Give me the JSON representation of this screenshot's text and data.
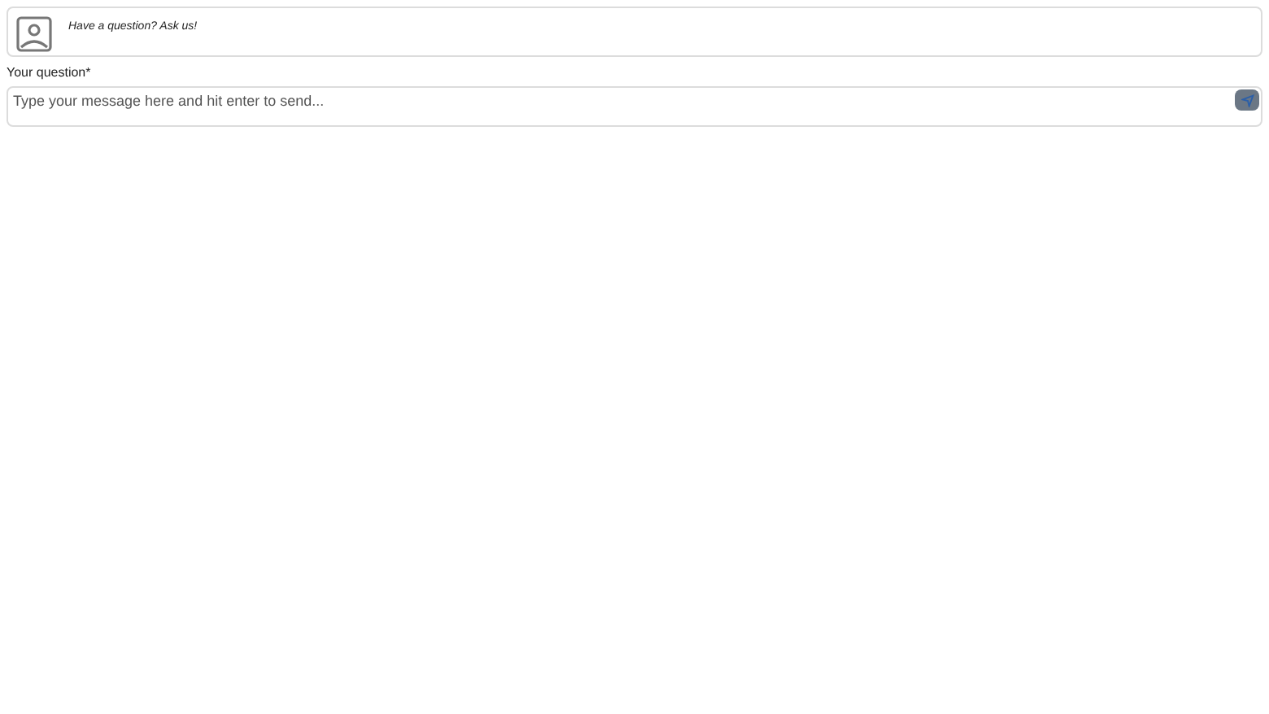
{
  "header": {
    "text": "Have a question? Ask us!"
  },
  "field": {
    "label": "Your question*",
    "placeholder": "Type your message here and hit enter to send..."
  }
}
